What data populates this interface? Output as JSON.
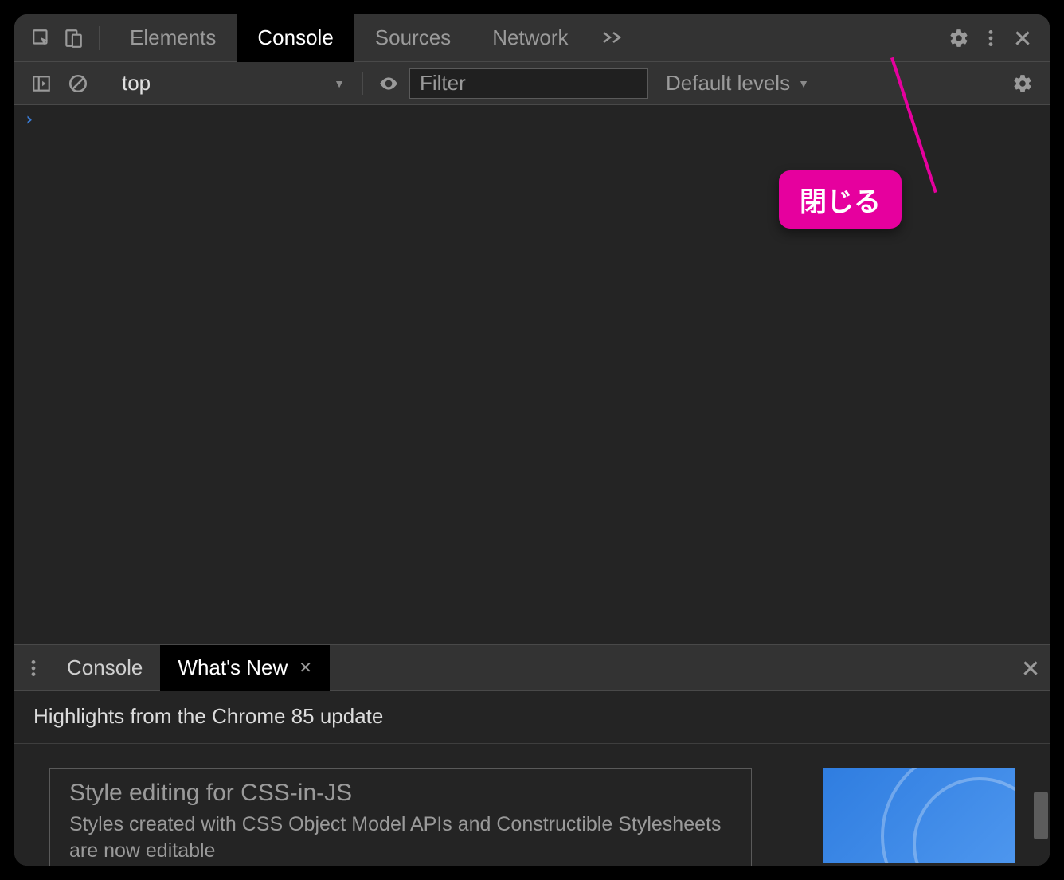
{
  "topTabs": {
    "items": [
      "Elements",
      "Console",
      "Sources",
      "Network"
    ],
    "active": "Console"
  },
  "consoleToolbar": {
    "context": "top",
    "filterPlaceholder": "Filter",
    "levels": "Default levels"
  },
  "annotation": {
    "label": "閉じる"
  },
  "drawer": {
    "tabs": [
      "Console",
      "What's New"
    ],
    "active": "What's New",
    "heading": "Highlights from the Chrome 85 update",
    "news": {
      "title": "Style editing for CSS-in-JS",
      "desc": "Styles created with CSS Object Model APIs and Constructible Stylesheets are now editable"
    }
  }
}
